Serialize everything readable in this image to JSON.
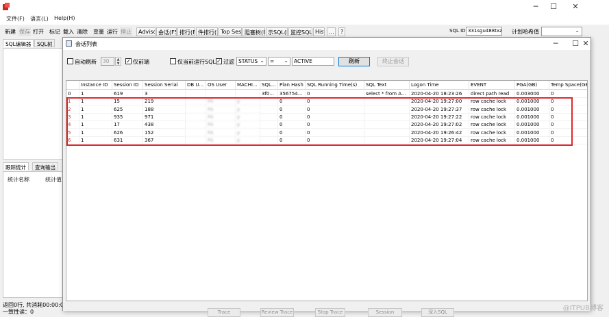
{
  "main": {
    "menu": [
      "文件(F)",
      "语言(L)",
      "Help(H)"
    ],
    "toolbar": {
      "items": [
        "新建",
        "保存",
        "打开",
        "标记",
        "载入",
        "清除",
        "变量",
        "运行",
        "停止",
        "Advisor",
        "会话(F5)",
        "排行(F",
        "件排行(F",
        "Top Session",
        "阻塞树(F",
        "示SQL(F",
        "监控SQL",
        "Hist",
        "...",
        "?"
      ],
      "sql_id_label": "SQL ID",
      "sql_id_value": "331sgu488txzu",
      "plan_hash_label": "计划哈希值"
    },
    "left_tabs": [
      "SQL编辑器",
      "SQL树"
    ],
    "stats_tabs": [
      "跟踪统计",
      "查询输出"
    ],
    "stats_headers": [
      "统计名称",
      "统计值"
    ],
    "status_line1": "返回0行, 共消耗00:00:00",
    "status_line2": "一致性读：0"
  },
  "dialog": {
    "title": "会话列表",
    "filters": {
      "auto_refresh_label": "自动刷新",
      "auto_refresh_checked": false,
      "interval_value": "30",
      "frontend_only_label": "仅前端",
      "frontend_only_checked": true,
      "running_sql_label": "仅当前运行SQL",
      "running_sql_checked": false,
      "filter_label": "过滤",
      "filter_checked": true,
      "filter_column": "STATUS",
      "filter_operator": "=",
      "filter_value": "ACTIVE",
      "refresh_button": "刷新",
      "kill_button": "终止会话"
    },
    "columns": [
      "",
      "Instance ID",
      "Session ID",
      "Session Serial",
      "DB U...",
      "OS User",
      "MACHI...",
      "SQL...",
      "Plan Hash",
      "SQL Running Time(s)",
      "SQL Text",
      "Logon Time",
      "EVENT",
      "PGA(GB)",
      "Temp Space(GB)"
    ],
    "rows": [
      [
        "0",
        "1",
        "619",
        "3",
        "",
        "",
        "",
        "3f0...",
        "356754...",
        "0",
        "select * from A...",
        "2020-04-20 18:23:26",
        "direct path read",
        "0.003000",
        "0"
      ],
      [
        "1",
        "1",
        "15",
        "219",
        "",
        "PA",
        "p",
        "",
        "0",
        "0",
        "",
        "2020-04-20 19:27:00",
        "row cache lock",
        "0.001000",
        "0"
      ],
      [
        "2",
        "1",
        "625",
        "188",
        "",
        "PA",
        "p",
        "",
        "0",
        "0",
        "",
        "2020-04-20 19:27:37",
        "row cache lock",
        "0.001000",
        "0"
      ],
      [
        "3",
        "1",
        "935",
        "971",
        "",
        "PA",
        "p",
        "",
        "0",
        "0",
        "",
        "2020-04-20 19:27:22",
        "row cache lock",
        "0.001000",
        "0"
      ],
      [
        "4",
        "1",
        "17",
        "438",
        "",
        "PA",
        "p",
        "",
        "0",
        "0",
        "",
        "2020-04-20 19:27:02",
        "row cache lock",
        "0.001000",
        "0"
      ],
      [
        "5",
        "1",
        "626",
        "152",
        "",
        "PA",
        "p",
        "",
        "0",
        "0",
        "",
        "2020-04-20 19:26:42",
        "row cache lock",
        "0.001000",
        "0"
      ],
      [
        "6",
        "1",
        "631",
        "367",
        "",
        "PA",
        "p",
        "",
        "0",
        "0",
        "",
        "2020-04-20 19:27:04",
        "row cache lock",
        "0.001000",
        "0"
      ]
    ],
    "actions": [
      "Trace Session",
      "Review Trace",
      "Stop Trace",
      "Session History",
      "深入SQL"
    ]
  },
  "watermark": "@ITPUB博客",
  "colors": {
    "highlight": "#e0262b",
    "primary_border": "#0078d7"
  }
}
